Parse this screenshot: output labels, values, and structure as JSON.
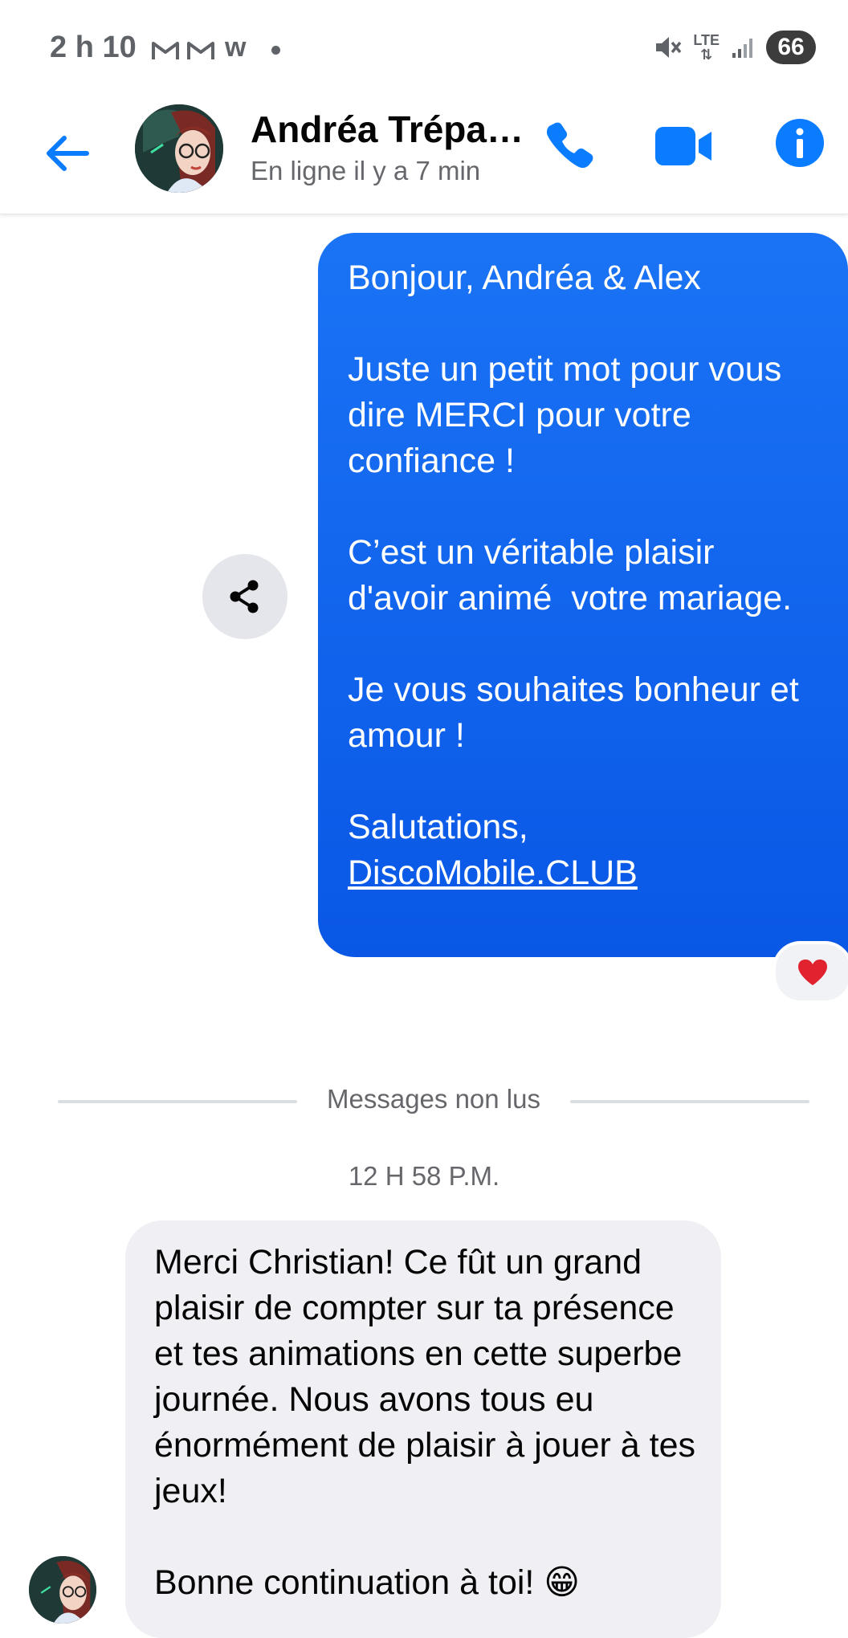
{
  "status_bar": {
    "time": "2 h 10",
    "network_icon_text": "LTE",
    "battery": "66",
    "icons": [
      "gmail-icon",
      "gmail-icon",
      "w-app-icon",
      "mute-icon",
      "lte-icon",
      "signal-icon",
      "battery-icon"
    ]
  },
  "header": {
    "contact_name": "Andréa Trépa…",
    "contact_status": "En ligne il y a 7 min",
    "icons": [
      "back-arrow-icon",
      "phone-icon",
      "video-icon",
      "info-icon"
    ],
    "accent_color": "#0a7cff"
  },
  "messages": {
    "outgoing": {
      "text": "Bonjour, Andréa & Alex\n\nJuste un petit mot pour vous dire MERCI pour votre confiance !\n\nC’est un véritable plaisir d'avoir animé  votre mariage.\n\nJe vous souhaites bonheur et amour !\n\nSalutations,",
      "link": "DiscoMobile.CLUB",
      "reaction": "❤️",
      "bubble_color": "#0a62ec"
    },
    "unread_divider": "Messages non lus",
    "timestamp": "12 H 58 P.M.",
    "incoming": {
      "text": "Merci Christian! Ce fût un grand plaisir de compter sur ta présence et tes animations en cette superbe journée. Nous avons tous eu énormément de plaisir à jouer à tes jeux!\n\nBonne continuation à toi! 😁",
      "bubble_color": "#f0f0f4"
    }
  }
}
